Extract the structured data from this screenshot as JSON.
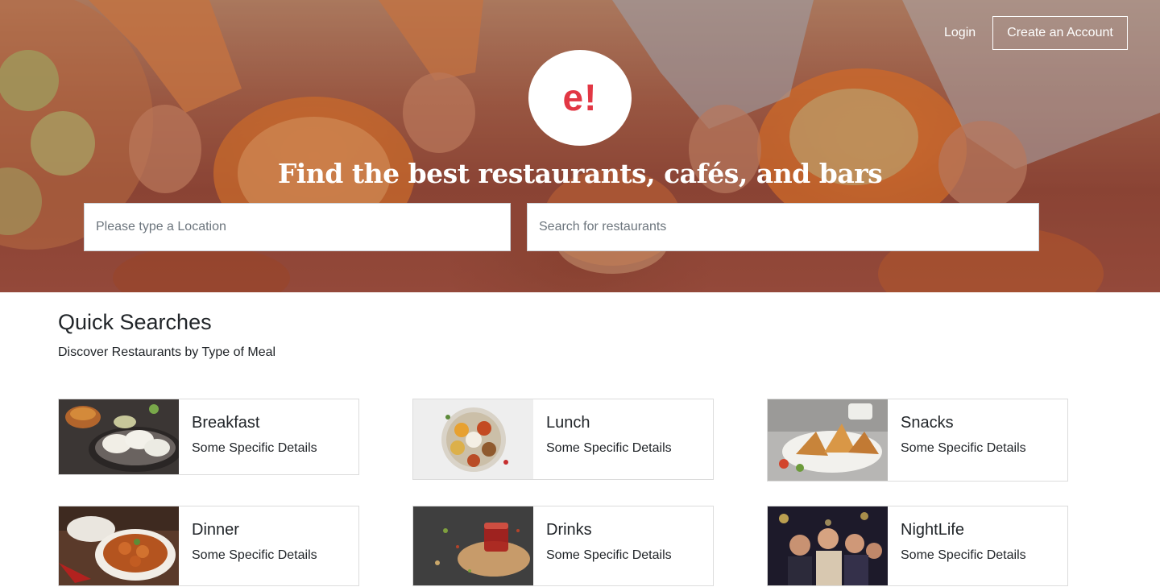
{
  "header": {
    "login_label": "Login",
    "create_account_label": "Create an Account",
    "logo_text": "e!",
    "title": "Find the best restaurants, cafés, and bars"
  },
  "search": {
    "location_placeholder": "Please type a Location",
    "restaurant_placeholder": "Search for restaurants"
  },
  "quick_searches": {
    "title": "Quick Searches",
    "subtitle": "Discover Restaurants by Type of Meal",
    "cards": [
      {
        "title": "Breakfast",
        "details": "Some Specific Details",
        "image": "breakfast-image"
      },
      {
        "title": "Lunch",
        "details": "Some Specific Details",
        "image": "lunch-image"
      },
      {
        "title": "Snacks",
        "details": "Some Specific Details",
        "image": "snacks-image"
      },
      {
        "title": "Dinner",
        "details": "Some Specific Details",
        "image": "dinner-image"
      },
      {
        "title": "Drinks",
        "details": "Some Specific Details",
        "image": "drinks-image"
      },
      {
        "title": "NightLife",
        "details": "Some Specific Details",
        "image": "nightlife-image"
      }
    ]
  },
  "colors": {
    "brand": "#e23744",
    "hero_overlay": "#8e4a3a",
    "text": "#212529",
    "card_border": "#dcdcdc"
  }
}
